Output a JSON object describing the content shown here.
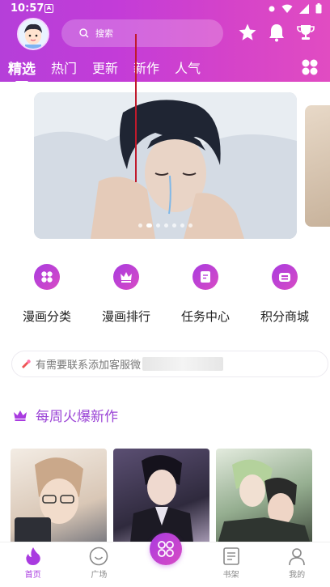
{
  "status": {
    "time": "10:57",
    "badge": "A"
  },
  "search": {
    "placeholder": "搜索"
  },
  "tabs": [
    {
      "label": "精选",
      "active": true
    },
    {
      "label": "热门"
    },
    {
      "label": "更新"
    },
    {
      "label": "新作"
    },
    {
      "label": "人气"
    }
  ],
  "banner": {
    "dots": 7,
    "active_index": 1
  },
  "menu": [
    {
      "label": "漫画分类",
      "icon": "grid-icon"
    },
    {
      "label": "漫画排行",
      "icon": "crown-icon"
    },
    {
      "label": "任务中心",
      "icon": "task-icon"
    },
    {
      "label": "积分商城",
      "icon": "shop-icon"
    }
  ],
  "notice": {
    "text": "有需要联系添加客服微"
  },
  "section": {
    "title": "每周火爆新作"
  },
  "nav": [
    {
      "label": "首页",
      "icon": "fire-icon",
      "active": true
    },
    {
      "label": "广场",
      "icon": "smile-icon"
    },
    {
      "label": "",
      "icon": "center-grid-icon"
    },
    {
      "label": "书架",
      "icon": "bookshelf-icon"
    },
    {
      "label": "我的",
      "icon": "user-icon"
    }
  ],
  "colors": {
    "accent": "#a93be0",
    "header_start": "#b53fd9",
    "header_end": "#e14cc2"
  }
}
